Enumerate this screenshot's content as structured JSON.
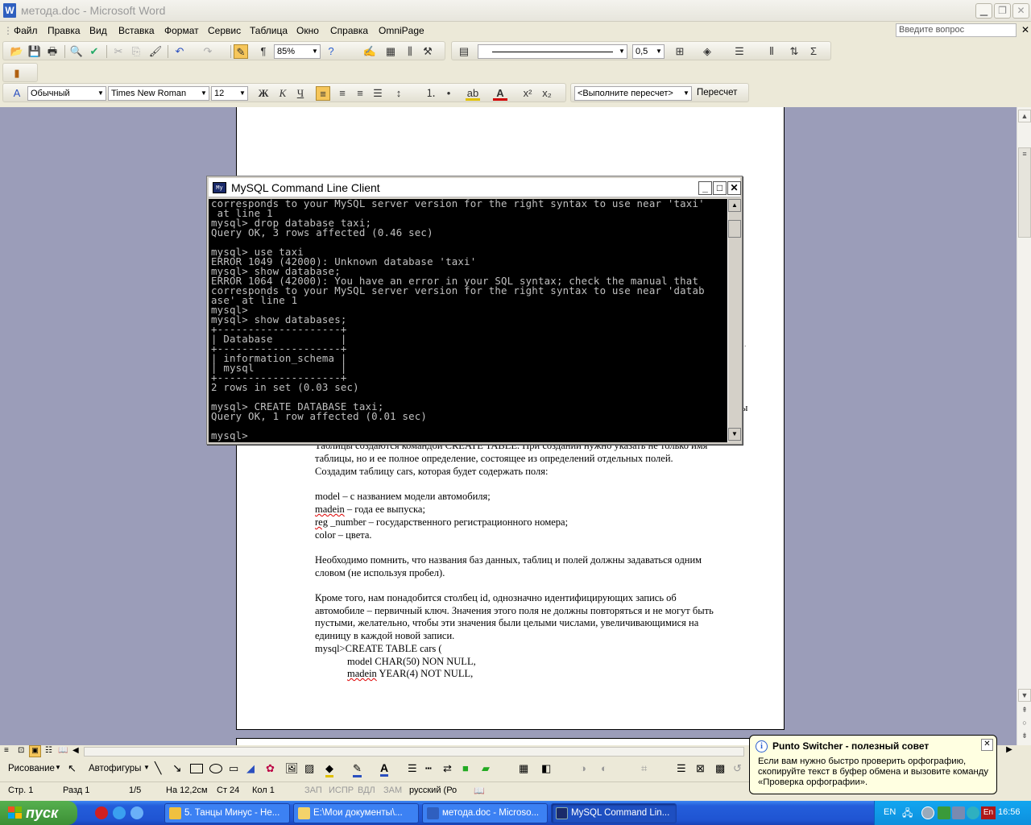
{
  "word": {
    "title": "метода.doc - Microsoft Word",
    "app_icon": "W",
    "menu": [
      "Файл",
      "Правка",
      "Вид",
      "Вставка",
      "Формат",
      "Сервис",
      "Таблица",
      "Окно",
      "Справка",
      "OmniPage"
    ],
    "ask_placeholder": "Введите вопрос",
    "toolbar_standard": {
      "zoom": "85%"
    },
    "toolbar_tables": {
      "line_weight": "0,5"
    },
    "toolbar_format": {
      "style": "Обычный",
      "font": "Times New Roman",
      "size": "12",
      "bold": "Ж",
      "italic": "К",
      "underline": "Ч",
      "recalc_combo": "<Выполните пересчет>",
      "recalc_button": "Пересчет"
    },
    "document_lines": [
      "Таблицы создаются командой CREATE TABLE. При создании нужно указать не только имя",
      "таблицы, но и ее полное определение, состоящее из определений отдельных полей.",
      "Создадим таблицу cars, которая будет содержать поля:",
      "model – с названием модели автомобиля;",
      "madein – года ее выпуска;",
      "reg _number – государственного регистрационного номера;",
      "color – цвета.",
      "Необходимо помнить, что названия баз данных, таблиц и полей должны задаваться одним",
      "словом (не используя пробел).",
      "Кроме того, нам понадобится столбец id, однозначно идентифицирующих запись об",
      "автомобиле – первичный ключ. Значения этого поля не должны повторяться и не могут быть",
      "пустыми, желательно, чтобы эти значения были целыми числами, увеличивающимися на",
      "единицу в каждой новой записи.",
      "mysql>CREATE TABLE cars (",
      "model CHAR(50) NON NULL,",
      "madein YEAR(4) NOT NULL,"
    ],
    "right_margin_fragment": "ы",
    "drawbar": {
      "drawing": "Рисование",
      "autoshapes": "Автофигуры"
    },
    "status": {
      "page": "Стр. 1",
      "section": "Разд 1",
      "pages": "1/5",
      "at": "На 12,2см",
      "line": "Ст 24",
      "col": "Кол 1",
      "rec": "ЗАП",
      "trk": "ИСПР",
      "ext": "ВДЛ",
      "ovr": "ЗАМ",
      "lang": "русский (Ро"
    }
  },
  "mysql": {
    "title": "MySQL Command Line Client",
    "icon_label": "My",
    "console_text": "corresponds to your MySQL server version for the right syntax to use near 'taxi'\n at line 1\nmysql> drop database taxi;\nQuery OK, 3 rows affected (0.46 sec)\n\nmysql> use taxi\nERROR 1049 (42000): Unknown database 'taxi'\nmysql> show database;\nERROR 1064 (42000): You have an error in your SQL syntax; check the manual that\ncorresponds to your MySQL server version for the right syntax to use near 'datab\nase' at line 1\nmysql>\nmysql> show databases;\n+--------------------+\n| Database           |\n+--------------------+\n| information_schema |\n| mysql              |\n+--------------------+\n2 rows in set (0.03 sec)\n\nmysql> CREATE DATABASE taxi;\nQuery OK, 1 row affected (0.01 sec)\n\nmysql>"
  },
  "balloon": {
    "title": "Punto Switcher - полезный совет",
    "text": "Если вам нужно быстро проверить орфографию, скопируйте текст в буфер обмена и вызовите команду «Проверка орфографии»."
  },
  "taskbar": {
    "start": "пуск",
    "tasks": [
      {
        "label": "5. Танцы Минус - Не...",
        "color": "#f0c040"
      },
      {
        "label": "E:\\Мои документы\\...",
        "color": "#f3d36a"
      },
      {
        "label": "метода.doc - Microso...",
        "color": "#2f5fbf"
      },
      {
        "label": "MySQL Command Lin...",
        "color": "#1a2a6a"
      }
    ],
    "lang": "EN",
    "punto": "En",
    "time": "16:56"
  }
}
